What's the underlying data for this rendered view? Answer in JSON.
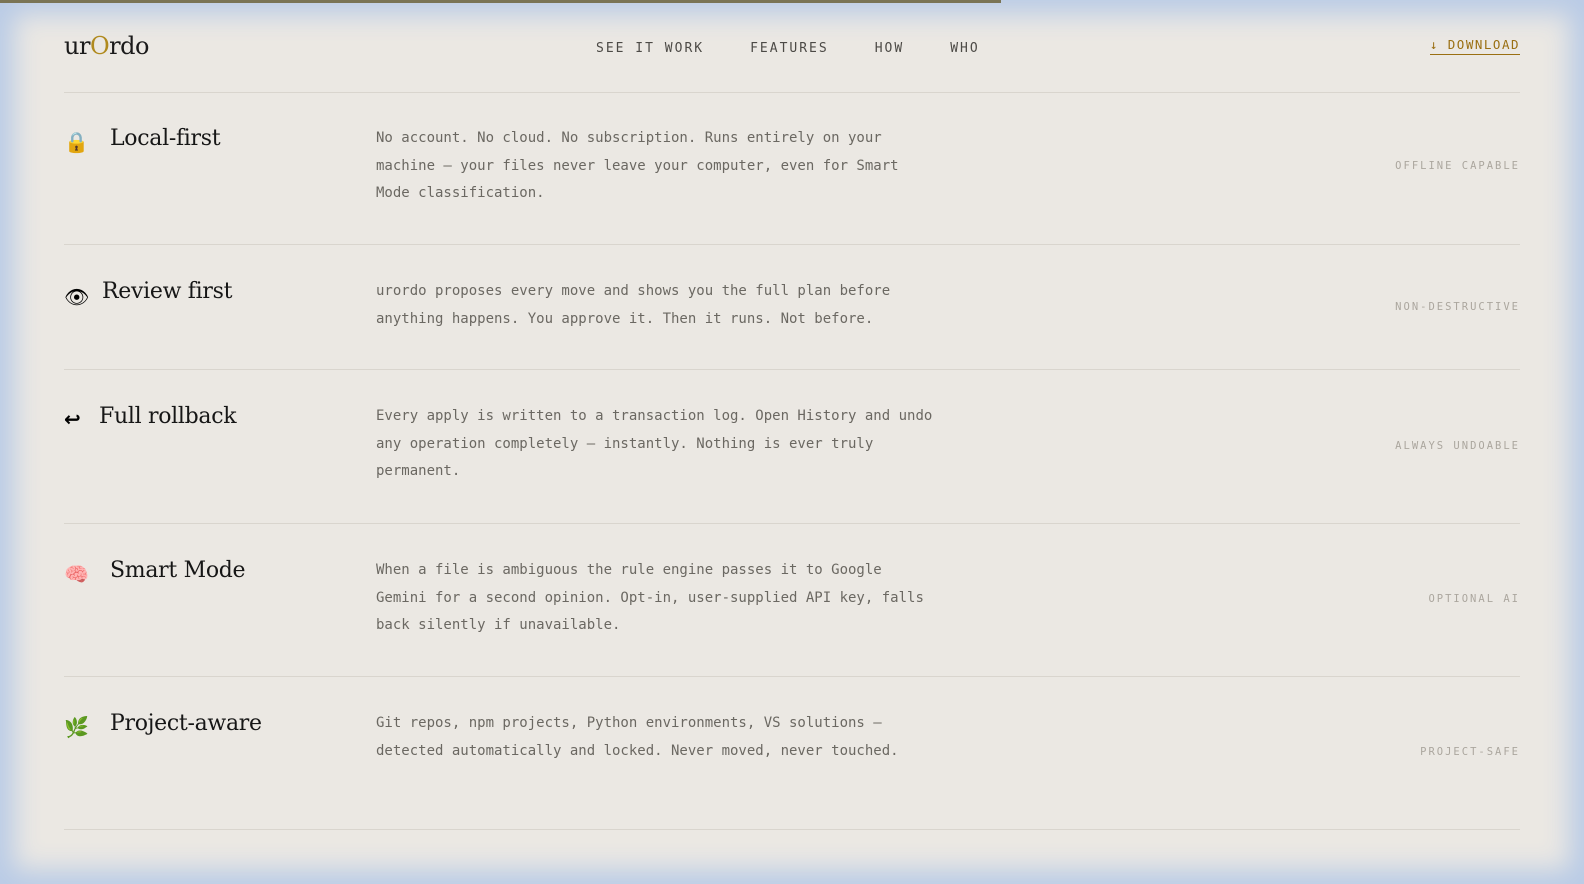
{
  "brand": {
    "part1": "ur",
    "part2": "O",
    "part3": "rdo"
  },
  "nav": [
    "SEE IT WORK",
    "FEATURES",
    "HOW",
    "WHO"
  ],
  "download_label": "↓ DOWNLOAD",
  "features": [
    {
      "icon": "lock-icon",
      "glyph": "🔒",
      "title": "Local-first",
      "desc": "No account. No cloud. No subscription. Runs entirely on your machine — your files never leave your computer, even for Smart Mode classification.",
      "tag": "OFFLINE CAPABLE"
    },
    {
      "icon": "eye-icon",
      "glyph": "👁",
      "title": "Review first",
      "desc": "urordo proposes every move and shows you the full plan before anything happens. You approve it. Then it runs. Not before.",
      "tag": "NON-DESTRUCTIVE"
    },
    {
      "icon": "undo-arrow-icon",
      "glyph": "↩",
      "title": "Full rollback",
      "desc": "Every apply is written to a transaction log. Open History and undo any operation completely — instantly. Nothing is ever truly permanent.",
      "tag": "ALWAYS UNDOABLE"
    },
    {
      "icon": "brain-icon",
      "glyph": "🧠",
      "title": "Smart Mode",
      "desc": "When a file is ambiguous the rule engine passes it to Google Gemini for a second opinion. Opt-in, user-supplied API key, falls back silently if unavailable.",
      "tag": "OPTIONAL AI"
    },
    {
      "icon": "herb-icon",
      "glyph": "🌿",
      "title": "Project-aware",
      "desc": "Git repos, npm projects, Python environments, VS solutions — detected automatically and locked. Never moved, never touched.",
      "tag": "PROJECT-SAFE"
    }
  ]
}
